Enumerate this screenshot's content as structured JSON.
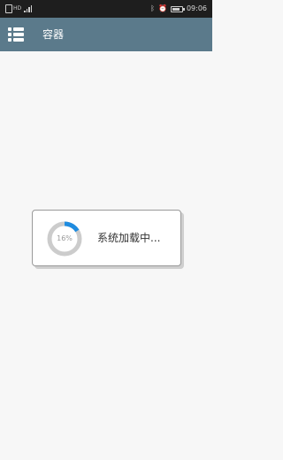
{
  "status_bar": {
    "network_text": "HD",
    "time": "09:06",
    "battery_level": 0.8,
    "icons": [
      "sim-icon",
      "signal-icon",
      "bluetooth-icon",
      "alarm-icon",
      "battery-icon"
    ]
  },
  "app_bar": {
    "title": "容器",
    "menu_icon": "menu-list-icon",
    "background_color": "#5b7a8b"
  },
  "loading": {
    "progress_label": "16%",
    "progress": 0.16,
    "message": "系统加载中...",
    "progress_color": "#1f8ce0",
    "track_color": "#cccccc"
  }
}
